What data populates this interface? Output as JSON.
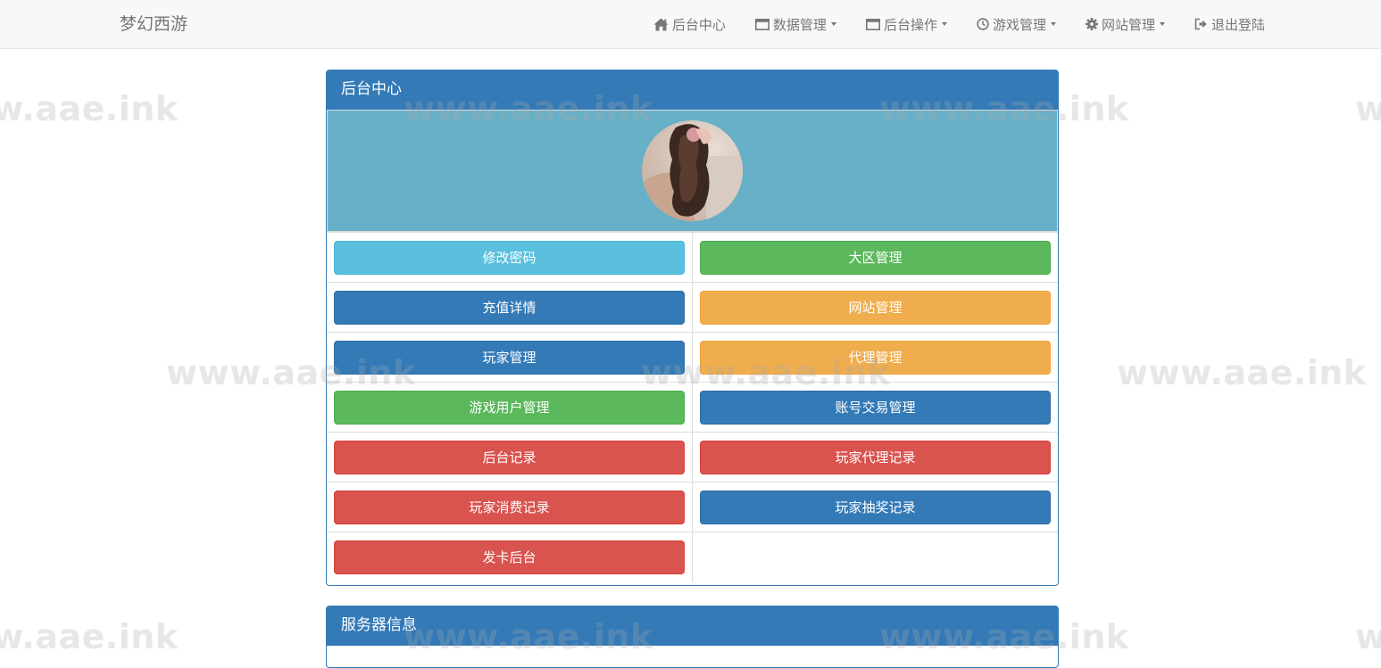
{
  "navbar": {
    "brand": "梦幻西游",
    "items": [
      {
        "label": "后台中心",
        "icon": "home-icon",
        "dropdown": false
      },
      {
        "label": "数据管理",
        "icon": "window-icon",
        "dropdown": true
      },
      {
        "label": "后台操作",
        "icon": "window-icon",
        "dropdown": true
      },
      {
        "label": "游戏管理",
        "icon": "clock-icon",
        "dropdown": true
      },
      {
        "label": "网站管理",
        "icon": "gear-icon",
        "dropdown": true
      },
      {
        "label": "退出登陆",
        "icon": "logout-icon",
        "dropdown": false
      }
    ]
  },
  "panel_center": {
    "title": "后台中心",
    "buttons": [
      {
        "label": "修改密码",
        "color": "#5bc0de"
      },
      {
        "label": "大区管理",
        "color": "#5cb85c"
      },
      {
        "label": "充值详情",
        "color": "#337ab7"
      },
      {
        "label": "网站管理",
        "color": "#f0ad4e"
      },
      {
        "label": "玩家管理",
        "color": "#337ab7"
      },
      {
        "label": "代理管理",
        "color": "#f0ad4e"
      },
      {
        "label": "游戏用户管理",
        "color": "#5cb85c"
      },
      {
        "label": "账号交易管理",
        "color": "#337ab7"
      },
      {
        "label": "后台记录",
        "color": "#d9534f"
      },
      {
        "label": "玩家代理记录",
        "color": "#d9534f"
      },
      {
        "label": "玩家消费记录",
        "color": "#d9534f"
      },
      {
        "label": "玩家抽奖记录",
        "color": "#337ab7"
      },
      {
        "label": "发卡后台",
        "color": "#d9534f"
      }
    ]
  },
  "panel_server": {
    "title": "服务器信息"
  },
  "watermark": {
    "text": "www.aae.ink"
  },
  "colors": {
    "primary": "#337ab7",
    "info": "#5bc0de",
    "success": "#5cb85c",
    "warning": "#f0ad4e",
    "danger": "#d9534f",
    "avatar_banner": "#67b0c8"
  }
}
